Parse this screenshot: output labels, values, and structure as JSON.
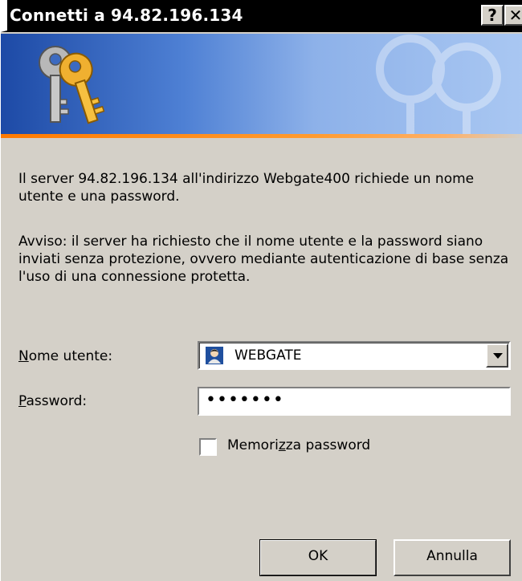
{
  "window": {
    "title": "Connetti a 94.82.196.134",
    "help_button": "?",
    "close_button": "✕"
  },
  "banner": {
    "accent": "#ff7a00",
    "gradient_start": "#1d4aa6",
    "gradient_end": "#a9c7f2",
    "icon": "keys-icon"
  },
  "message": {
    "intro": "Il server 94.82.196.134 all'indirizzo Webgate400 richiede un nome utente e una password.",
    "warning": "Avviso: il server ha richiesto che il nome utente e la password siano inviati senza protezione, ovvero mediante autenticazione di base senza l'uso di una connessione protetta."
  },
  "form": {
    "username_label_first": "N",
    "username_label_rest": "ome utente:",
    "username_value": "WEBGATE",
    "password_label_first": "P",
    "password_label_rest": "assword:",
    "password_value": "•••••••",
    "remember_label_pre": "Memori",
    "remember_label_u": "z",
    "remember_label_post": "za password",
    "remember_checked": false
  },
  "buttons": {
    "ok": "OK",
    "cancel": "Annulla"
  }
}
